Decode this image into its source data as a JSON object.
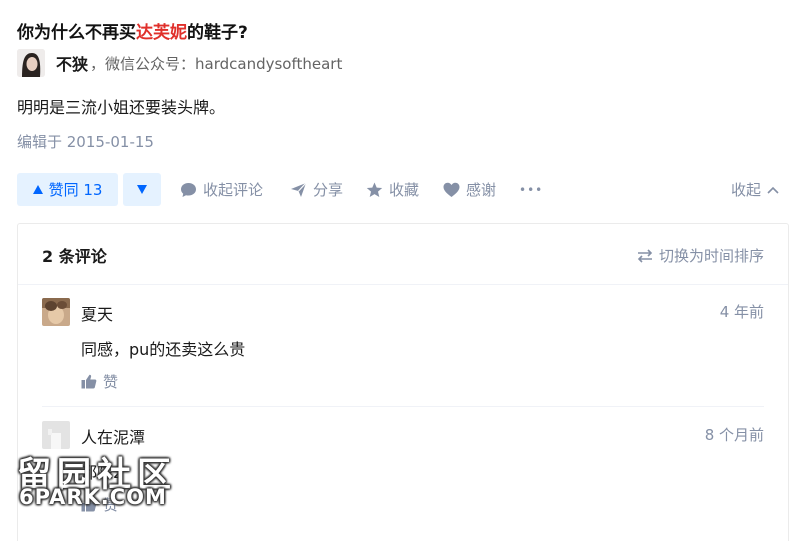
{
  "question": {
    "title_prefix": "你为什么不再买",
    "title_highlight": "达芙妮",
    "title_suffix": "的鞋子?",
    "highlight_color": "#e0302b"
  },
  "answer": {
    "author_name": "不狭",
    "author_bio": "，微信公众号：hardcandysoftheart",
    "content": "明明是三流小姐还要装头牌。",
    "edited": "编辑于 2015-01-15"
  },
  "actions": {
    "vote_up_label": "赞同 13",
    "collapse_comments": "收起评论",
    "share": "分享",
    "favorite": "收藏",
    "thanks": "感谢",
    "more": "•••",
    "collapse": "收起"
  },
  "comments": {
    "count_label": "2 条评论",
    "sort_label": "切换为时间排序",
    "items": [
      {
        "author": "夏天",
        "time": "4 年前",
        "text": "同感，pu的还卖这么贵",
        "like_label": "赞"
      },
      {
        "author": "人在泥潭",
        "time": "8 个月前",
        "text": "都陈2",
        "like_label": "赞"
      }
    ]
  },
  "watermark": {
    "cn": "留园社区",
    "en": "6PARK.COM"
  },
  "colors": {
    "accent": "#0066ff",
    "accent_bg": "#e5f2ff",
    "muted": "#8590a6"
  }
}
